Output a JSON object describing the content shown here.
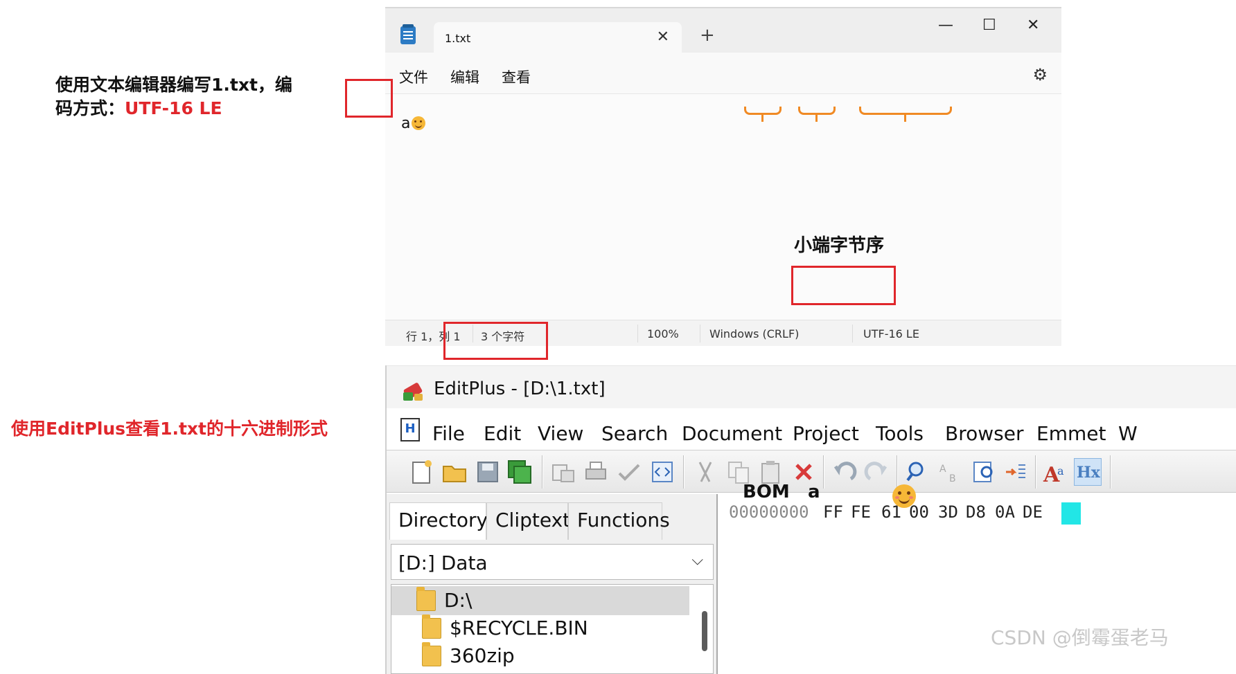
{
  "annotations": {
    "notepad_caption_line1": "使用文本编辑器编写1.txt，编",
    "notepad_caption_line2_prefix": "码方式：",
    "notepad_caption_line2_value": "UTF-16 LE",
    "endianness_label": "小端字节序",
    "editplus_caption": "使用EditPlus查看1.txt的十六进制形式",
    "bom_label": "BOM",
    "a_label": "a"
  },
  "notepad": {
    "tab_title": "1.txt",
    "tab_close": "✕",
    "new_tab": "+",
    "window_buttons": {
      "minimize": "—",
      "maximize": "☐",
      "close": "✕"
    },
    "menu": [
      "文件",
      "编辑",
      "查看"
    ],
    "content": "a",
    "status": {
      "position": "行 1，列 1",
      "char_count": "3 个字符",
      "zoom": "100%",
      "line_ending": "Windows (CRLF)",
      "encoding": "UTF-16 LE"
    }
  },
  "editplus": {
    "app_name": "EditPlus",
    "title_suffix": " - [D:\\1.txt]",
    "doc_icon_letter": "H",
    "menu": [
      "File",
      "Edit",
      "View",
      "Search",
      "Document",
      "Project",
      "Tools",
      "Browser",
      "Emmet",
      "W"
    ],
    "panel_tabs": [
      "Directory",
      "Cliptext",
      "Functions"
    ],
    "drive": "[D:] Data",
    "drive_arrow": "⌵",
    "tree": [
      "D:\\",
      "$RECYCLE.BIN",
      "360zip"
    ],
    "hex": {
      "address": "00000000",
      "bytes": [
        "FF",
        "FE",
        "61",
        "00",
        "3D",
        "D8",
        "0A",
        "DE"
      ]
    }
  },
  "colors": {
    "annotation_red": "#e0262b",
    "brace_orange": "#f08a24",
    "hex_cursor": "#22e6e6"
  },
  "watermark": "CSDN @倒霉蛋老马"
}
